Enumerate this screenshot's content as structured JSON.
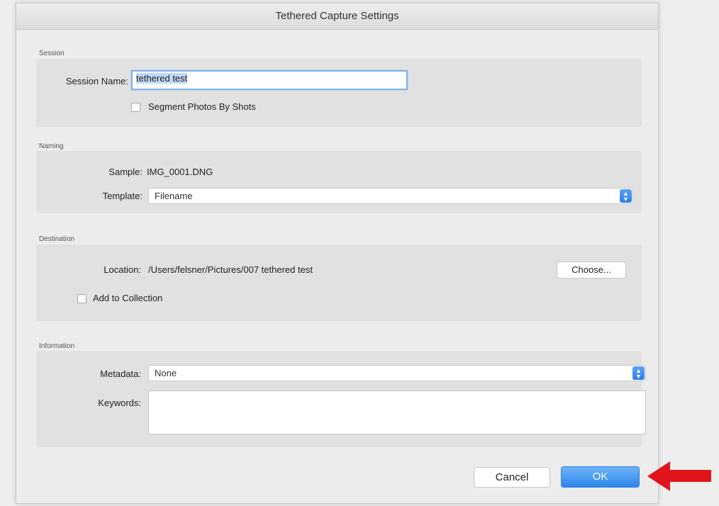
{
  "dialog": {
    "title": "Tethered Capture Settings"
  },
  "session": {
    "section_label": "Session",
    "name_label": "Session Name:",
    "name_value": "tethered test",
    "segment_label": "Segment Photos By Shots",
    "segment_checked": false
  },
  "naming": {
    "section_label": "Naming",
    "sample_label": "Sample:",
    "sample_value": "IMG_0001.DNG",
    "template_label": "Template:",
    "template_value": "Filename"
  },
  "destination": {
    "section_label": "Destination",
    "location_label": "Location:",
    "location_value": "/Users/felsner/Pictures/007 tethered test",
    "choose_label": "Choose...",
    "add_collection_label": "Add to Collection",
    "add_collection_checked": false
  },
  "information": {
    "section_label": "Information",
    "metadata_label": "Metadata:",
    "metadata_value": "None",
    "keywords_label": "Keywords:",
    "keywords_value": ""
  },
  "buttons": {
    "cancel_label": "Cancel",
    "ok_label": "OK"
  },
  "colors": {
    "accent": "#2d85ea",
    "annotation_arrow": "#e0151b"
  },
  "icons": {
    "popup_arrows": "up-down-chevron-icon",
    "annotation": "red-arrow-icon"
  }
}
